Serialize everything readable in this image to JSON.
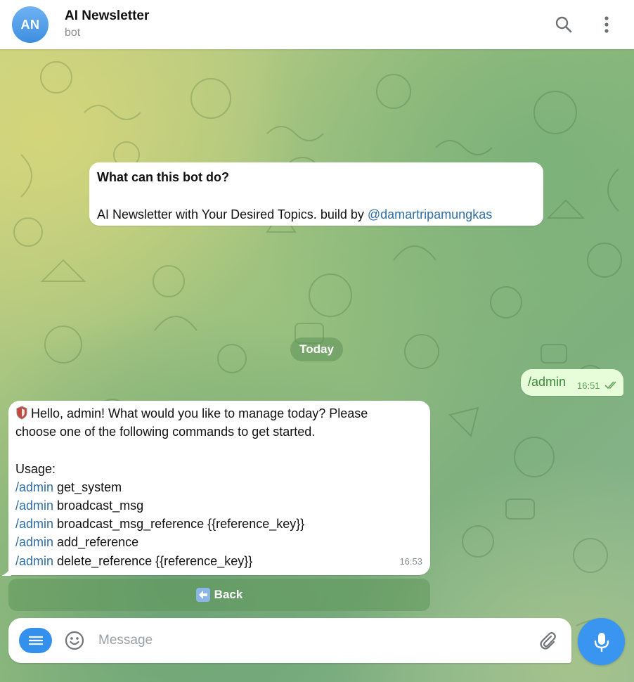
{
  "header": {
    "avatar_initials": "AN",
    "title": "AI Newsletter",
    "subtitle": "bot",
    "icons": [
      "search-icon",
      "more-vertical-icon"
    ]
  },
  "info_card": {
    "question": "What can this bot do?",
    "description_prefix": "AI Newsletter with Your Desired Topics. build by ",
    "description_link": "@damartripamungkas"
  },
  "date_separator": "Today",
  "outgoing_message": {
    "text": "/admin",
    "time": "16:51",
    "status": "read"
  },
  "incoming_message": {
    "line1": "Hello, admin! What would you like to manage today? Please",
    "line2": "choose one of the following commands to get started.",
    "usage_label": "Usage:",
    "commands": [
      {
        "cmd": "/admin",
        "arg": " get_system"
      },
      {
        "cmd": "/admin",
        "arg": " broadcast_msg"
      },
      {
        "cmd": "/admin",
        "arg": " broadcast_msg_reference {{reference_key}}"
      },
      {
        "cmd": "/admin",
        "arg": " add_reference"
      },
      {
        "cmd": "/admin",
        "arg": " delete_reference {{reference_key}}"
      }
    ],
    "time": "16:53"
  },
  "keyboard": {
    "back_label": "Back"
  },
  "composer": {
    "placeholder": "Message"
  },
  "colors": {
    "accent": "#3390ec",
    "link": "#2f6ea5",
    "outgoing_bubble": "#e7fcd8"
  }
}
